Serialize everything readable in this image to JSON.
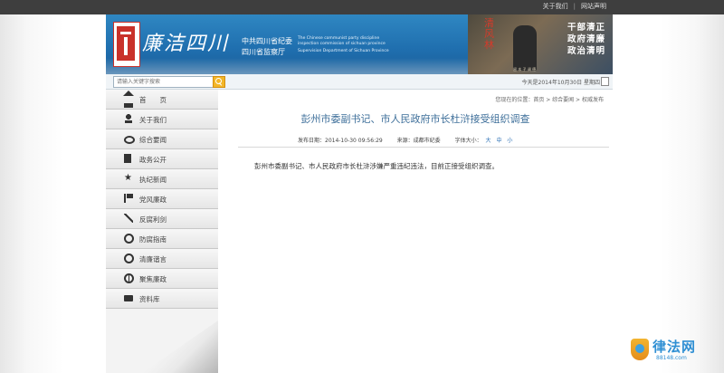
{
  "topbar": {
    "links": [
      "关于我们",
      "网站声明"
    ]
  },
  "banner": {
    "logo_calligraphy": "廉洁四川",
    "org_cn_line1": "中共四川省纪委",
    "org_cn_line2": "四川省监察厅",
    "org_en_line1": "The Chinese communist party discipline",
    "org_en_line2": "inspection commission of sichuan province",
    "org_en_line3": "Supervision Department of Sichuan Province",
    "photo_title": "清风林",
    "photo_caption": "留 本 子 调 德",
    "slogans": [
      "干部清正",
      "政府清廉",
      "政治清明"
    ]
  },
  "toolbar": {
    "search_placeholder": "请输入关键字搜索",
    "date_text": "今天是2014年10月30日 星期四"
  },
  "sidebar": {
    "items": [
      {
        "label": "首　　页",
        "icon": "home-icon"
      },
      {
        "label": "关于我们",
        "icon": "person-icon"
      },
      {
        "label": "综合要闻",
        "icon": "eye-icon"
      },
      {
        "label": "政务公开",
        "icon": "document-icon"
      },
      {
        "label": "执纪新闻",
        "icon": "star-icon"
      },
      {
        "label": "党风廉政",
        "icon": "flag-icon"
      },
      {
        "label": "反腐利剑",
        "icon": "sword-icon"
      },
      {
        "label": "防腐指南",
        "icon": "compass-icon"
      },
      {
        "label": "清廉谐言",
        "icon": "clock-icon"
      },
      {
        "label": "聚焦廉政",
        "icon": "globe-icon"
      },
      {
        "label": "资料库",
        "icon": "folder-icon"
      }
    ]
  },
  "content": {
    "breadcrumb": "您现在的位置：首页 > 综合要闻 > 权威发布",
    "title": "彭州市委副书记、市人民政府市长杜浒接受组织调查",
    "meta": {
      "date": "发布日期：2014-10-30 09:56:29",
      "source": "来源：成都市纪委",
      "font_size_label": "字体大小：",
      "size_large": "大",
      "size_medium": "中",
      "size_small": "小"
    },
    "body": "彭州市委副书记、市人民政府市长杜浒涉嫌严重违纪违法，目前正接受组织调查。"
  },
  "watermark": {
    "name": "律法网",
    "domain": "88148.com"
  }
}
